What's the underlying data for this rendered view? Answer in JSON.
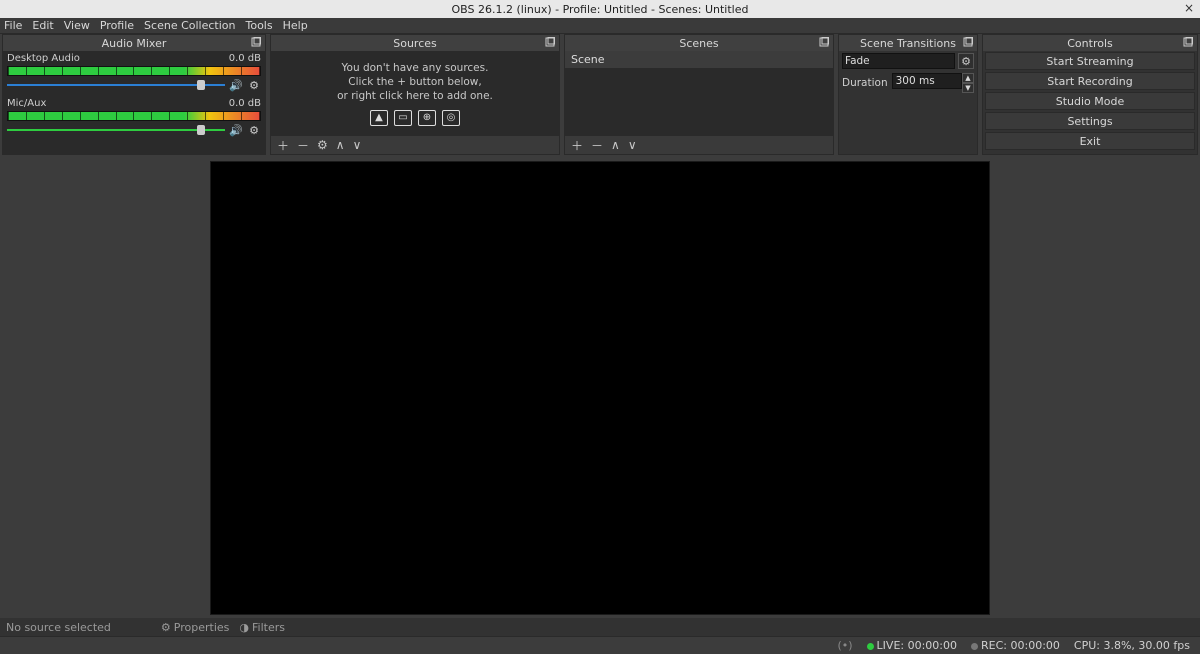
{
  "window": {
    "title": "OBS 26.1.2 (linux) - Profile: Untitled - Scenes: Untitled"
  },
  "menubar": [
    "File",
    "Edit",
    "View",
    "Profile",
    "Scene Collection",
    "Tools",
    "Help"
  ],
  "mixer": {
    "title": "Audio Mixer",
    "channels": [
      {
        "name": "Desktop Audio",
        "level": "0.0 dB"
      },
      {
        "name": "Mic/Aux",
        "level": "0.0 dB"
      }
    ]
  },
  "sources": {
    "title": "Sources",
    "empty1": "You don't have any sources.",
    "empty2": "Click the + button below,",
    "empty3": "or right click here to add one."
  },
  "scenes": {
    "title": "Scenes",
    "items": [
      "Scene"
    ]
  },
  "transitions": {
    "title": "Scene Transitions",
    "selected": "Fade",
    "duration_label": "Duration",
    "duration_value": "300 ms"
  },
  "controls": {
    "title": "Controls",
    "buttons": [
      "Start Streaming",
      "Start Recording",
      "Studio Mode",
      "Settings",
      "Exit"
    ]
  },
  "srcbar": {
    "no_selection": "No source selected",
    "properties": "Properties",
    "filters": "Filters"
  },
  "statusbar": {
    "live": "LIVE: 00:00:00",
    "rec": "REC: 00:00:00",
    "cpu": "CPU: 3.8%, 30.00 fps"
  }
}
